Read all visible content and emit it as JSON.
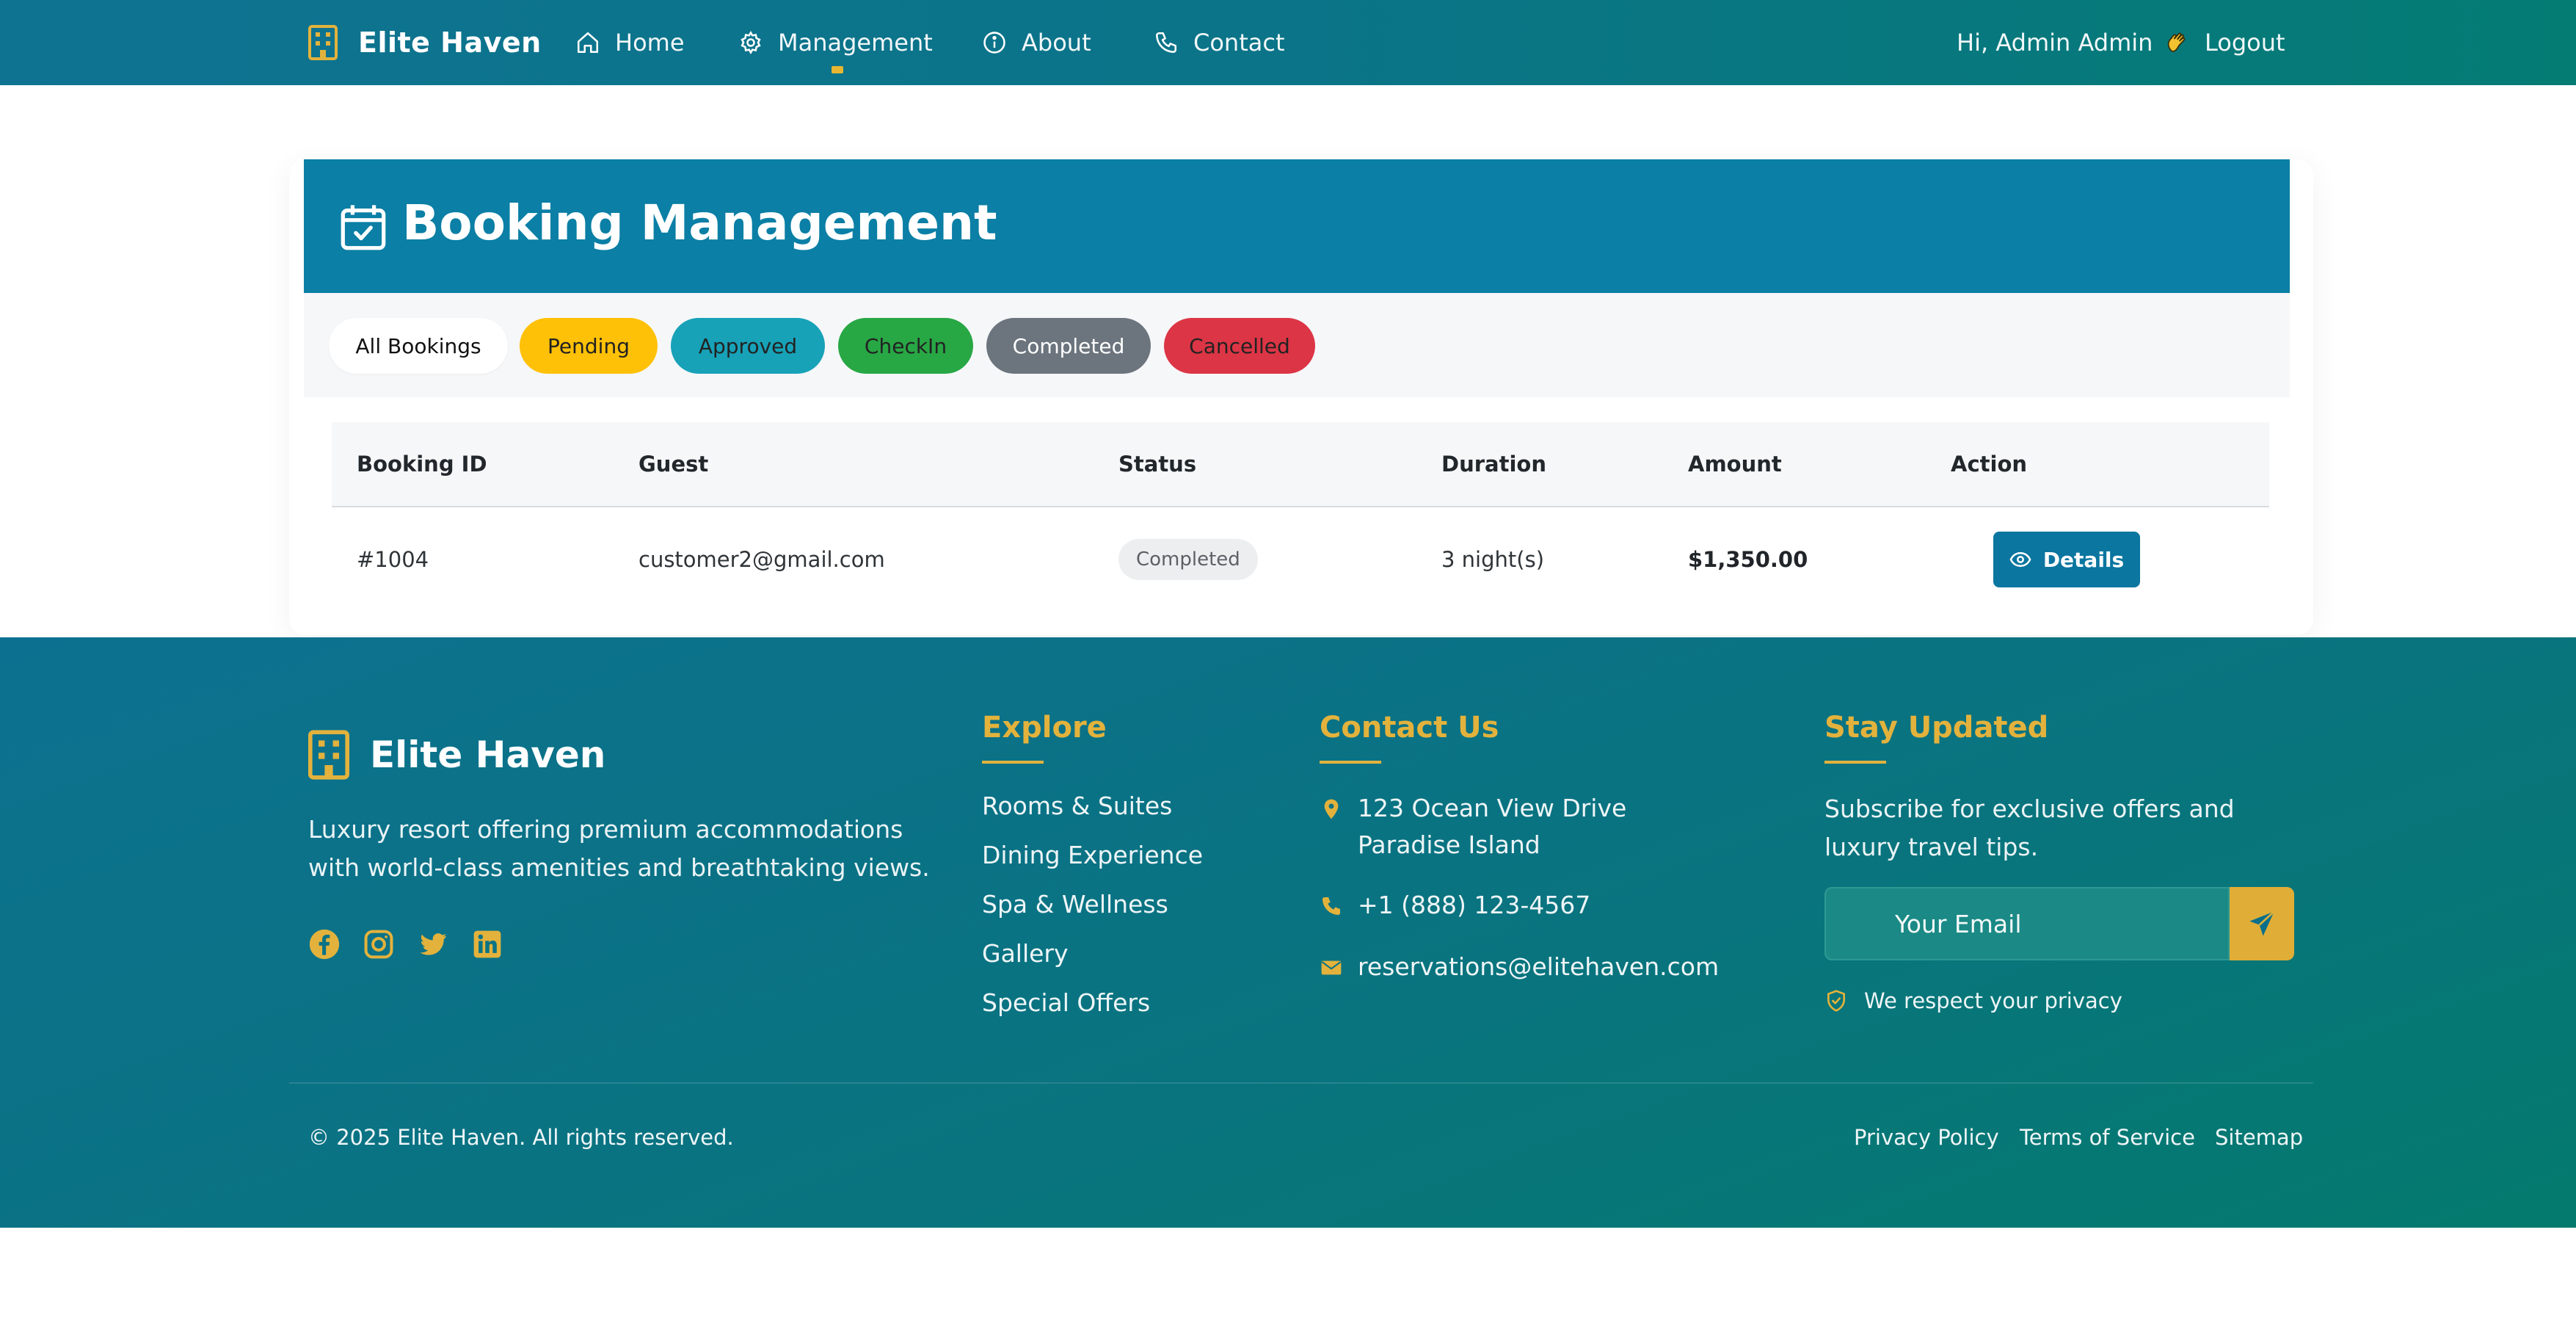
{
  "colors": {
    "brand_gold": "#e3b23c",
    "header_blue": "#0b7fa5",
    "teal": "#047c74",
    "pending": "#ffc107",
    "approved": "#17a2b8",
    "checkin": "#28a745",
    "completed": "#6c757d",
    "cancelled": "#dc3545"
  },
  "nav": {
    "brand": "Elite Haven",
    "items": [
      {
        "label": "Home",
        "icon": "home-icon"
      },
      {
        "label": "Management",
        "icon": "gear-icon"
      },
      {
        "label": "About",
        "icon": "info-icon"
      },
      {
        "label": "Contact",
        "icon": "phone-icon"
      }
    ],
    "greeting": "Hi, Admin Admin",
    "logout": "Logout"
  },
  "page": {
    "title": "Booking Management",
    "filters": [
      "All Bookings",
      "Pending",
      "Approved",
      "CheckIn",
      "Completed",
      "Cancelled"
    ]
  },
  "table": {
    "headers": [
      "Booking ID",
      "Guest",
      "Status",
      "Duration",
      "Amount",
      "Action"
    ],
    "rows": [
      {
        "id": "#1004",
        "guest": "customer2@gmail.com",
        "status": "Completed",
        "duration": "3 night(s)",
        "amount": "$1,350.00",
        "action": "Details"
      }
    ]
  },
  "footer": {
    "brand": "Elite Haven",
    "description": "Luxury resort offering premium accommodations with world-class amenities and breathtaking views.",
    "social": [
      "facebook-icon",
      "instagram-icon",
      "twitter-icon",
      "linkedin-icon"
    ],
    "explore": {
      "heading": "Explore",
      "links": [
        "Rooms & Suites",
        "Dining Experience",
        "Spa & Wellness",
        "Gallery",
        "Special Offers"
      ]
    },
    "contact": {
      "heading": "Contact Us",
      "address_line1": "123 Ocean View Drive",
      "address_line2": "Paradise Island",
      "phone": "+1 (888) 123-4567",
      "email": "reservations@elitehaven.com"
    },
    "newsletter": {
      "heading": "Stay Updated",
      "text": "Subscribe for exclusive offers and luxury travel tips.",
      "placeholder": "Your Email",
      "privacy": "We respect your privacy"
    },
    "copyright": "© 2025 Elite Haven. All rights reserved.",
    "bottom_links": [
      "Privacy Policy",
      "Terms of Service",
      "Sitemap"
    ]
  }
}
